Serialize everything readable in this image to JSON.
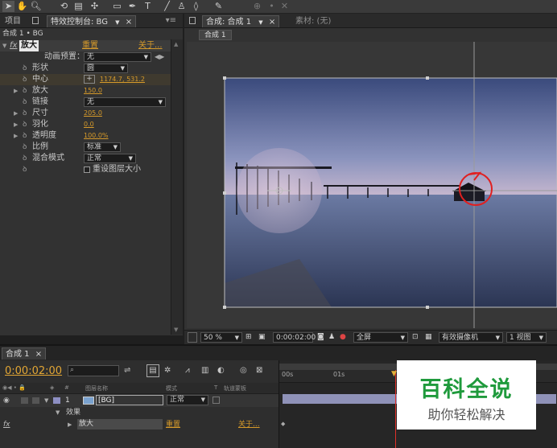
{
  "left_panel": {
    "tabs": [
      "项目",
      "特效控制台: BG"
    ],
    "header": "合成 1 • BG",
    "effect": {
      "name": "放大",
      "reset": "重置",
      "about": "关于..."
    },
    "animation_preset": {
      "label": "动画预置：",
      "value": "无"
    },
    "properties": [
      {
        "name": "形状",
        "dropdown": "圆"
      },
      {
        "name": "中心",
        "value": "1174.7, 531.2"
      },
      {
        "name": "放大",
        "value": "150.0"
      },
      {
        "name": "链接",
        "dropdown": "无"
      },
      {
        "name": "尺寸",
        "value": "205.0"
      },
      {
        "name": "羽化",
        "value": "0.0"
      },
      {
        "name": "透明度",
        "value": "100.0%"
      },
      {
        "name": "比例",
        "dropdown": "标准"
      },
      {
        "name": "混合模式",
        "dropdown": "正常"
      }
    ],
    "checkbox": "重设图层大小"
  },
  "right_panel": {
    "tabs": [
      "合成: 合成 1",
      "素材: (无)"
    ],
    "subtab": "合成 1",
    "footer": {
      "zoom": "50 %",
      "time": "0:00:02:00",
      "resolution": "全屏",
      "camera": "有效摄像机",
      "views": "1 视图"
    }
  },
  "timeline": {
    "tab": "合成 1",
    "timecode": "0:00:02:00",
    "columns": [
      "图层名称",
      "模式",
      "T",
      "轨道蒙板"
    ],
    "layer": {
      "num": "1",
      "name": "[BG]",
      "mode": "正常"
    },
    "effects_label": "效果",
    "effect": {
      "fx": "fx",
      "name": "放大",
      "reset": "重置",
      "about": "关于..."
    },
    "ruler": [
      "00s",
      "01s"
    ]
  },
  "watermark": {
    "title": "百科全说",
    "subtitle": "助你轻松解决"
  }
}
